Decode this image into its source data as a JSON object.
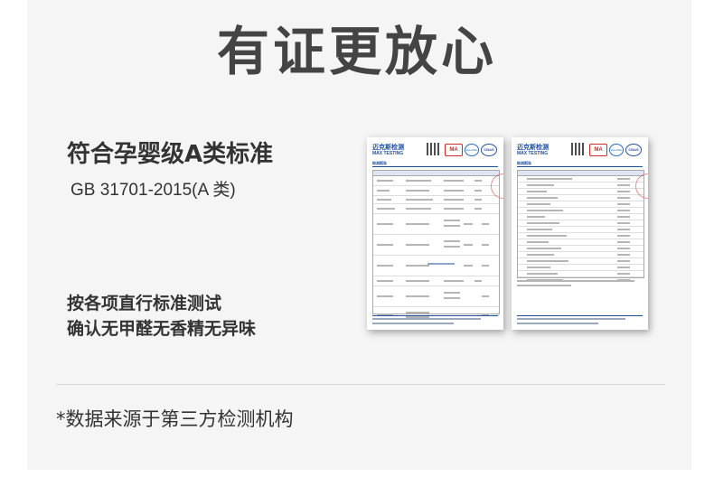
{
  "page": {
    "title": "有证更放心",
    "heading": "符合孕婴级A类标准",
    "standard": "GB 31701-2015(A 类)",
    "desc_line1": "按各项直行标准测试",
    "desc_line2": "确认无甲醛无香精无异味",
    "footnote": "*数据来源于第三方检测机构"
  },
  "reports": [
    {
      "brand_cn": "迈克斯检测",
      "brand_en": "MAX TESTING",
      "doc_title": "检测报告"
    },
    {
      "brand_cn": "迈克斯检测",
      "brand_en": "MAX TESTING",
      "doc_title": "检测报告"
    }
  ],
  "badges": {
    "cma": "MA",
    "ilac": "ilac-MRA",
    "cnas": "CNAS"
  },
  "colors": {
    "title": "#444444",
    "text": "#333333",
    "panel": "#f5f5f5",
    "brand": "#1b4f9c"
  }
}
